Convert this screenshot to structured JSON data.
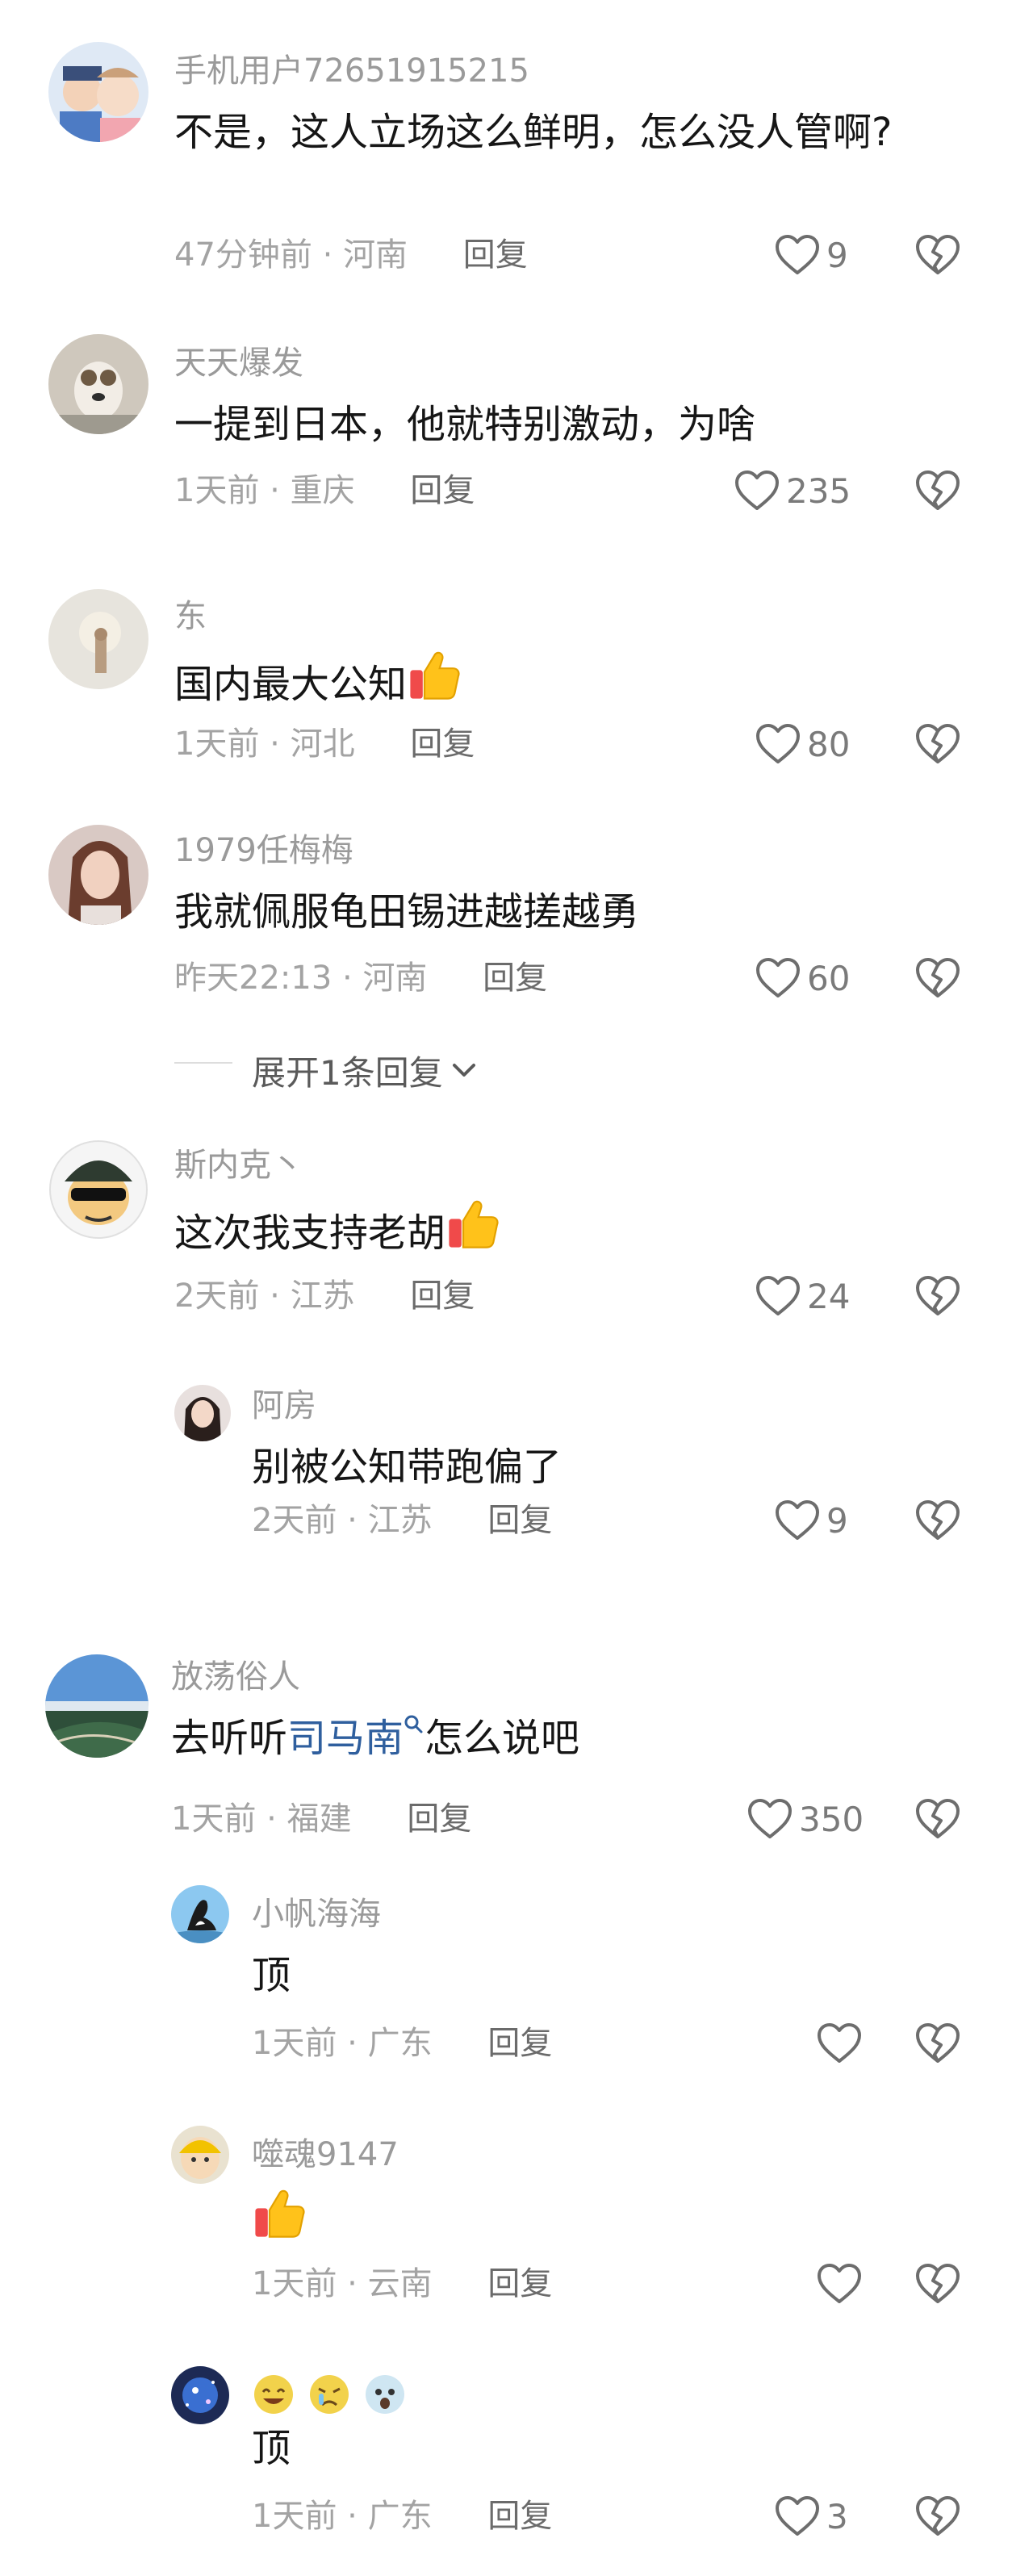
{
  "comments": [
    {
      "user": "手机用户72651915215",
      "text": "不是，这人立场这么鲜明，怎么没人管啊?",
      "time": "47分钟前",
      "location": "河南",
      "reply": "回复",
      "likes": "9"
    },
    {
      "user": "天天爆发",
      "text": "一提到日本，他就特别激动，为啥",
      "time": "1天前",
      "location": "重庆",
      "reply": "回复",
      "likes": "235"
    },
    {
      "user": "东",
      "text": "国内最大公知",
      "time": "1天前",
      "location": "河北",
      "reply": "回复",
      "likes": "80"
    },
    {
      "user": "1979任梅梅",
      "text": "我就佩服龟田锡进越搓越勇",
      "time": "昨天22:13",
      "location": "河南",
      "reply": "回复",
      "likes": "60",
      "expand": "展开1条回复"
    },
    {
      "user": "斯内克丶",
      "text": "这次我支持老胡",
      "time": "2天前",
      "location": "江苏",
      "reply": "回复",
      "likes": "24",
      "replies": [
        {
          "user": "阿房",
          "text": "别被公知带跑偏了",
          "time": "2天前",
          "location": "江苏",
          "reply": "回复",
          "likes": "9"
        }
      ]
    },
    {
      "user": "放荡俗人",
      "text_before": "去听听",
      "link": "司马南",
      "text_after": "怎么说吧",
      "time": "1天前",
      "location": "福建",
      "reply": "回复",
      "likes": "350",
      "replies": [
        {
          "user": "小帆海海",
          "text": "顶",
          "time": "1天前",
          "location": "广东",
          "reply": "回复",
          "likes": ""
        },
        {
          "user": "噬魂9147",
          "text": "",
          "time": "1天前",
          "location": "云南",
          "reply": "回复",
          "likes": ""
        },
        {
          "user": "",
          "text": "顶",
          "time": "1天前",
          "location": "广东",
          "reply": "回复",
          "likes": "3"
        }
      ]
    }
  ],
  "separator": "·",
  "icons": {
    "like": "heart-outline-icon",
    "dislike": "broken-heart-icon",
    "thumbs_up": "thumbs-up-emoji",
    "search": "search-icon",
    "expand": "chevron-down-icon"
  },
  "colors": {
    "link": "#2f5f9e",
    "username": "#9a9a9a",
    "meta": "#a3a3a3"
  }
}
